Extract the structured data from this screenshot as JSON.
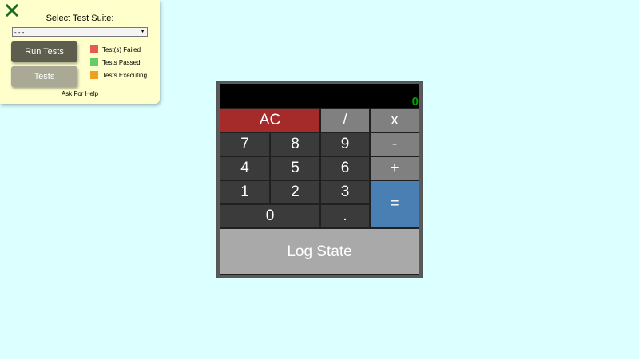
{
  "test_panel": {
    "title": "Select Test Suite:",
    "suite_select": {
      "selected": "- - -"
    },
    "run_tests_label": "Run Tests",
    "tests_label": "Tests",
    "legend": [
      {
        "label": "Test(s) Failed",
        "color": "#e85a4f"
      },
      {
        "label": "Tests Passed",
        "color": "#66cc66"
      },
      {
        "label": "Tests Executing",
        "color": "#f0a020"
      }
    ],
    "help_label": "Ask For Help",
    "close_icon": "close-icon",
    "close_color": "#1f6b1f"
  },
  "calculator": {
    "display_value": "0",
    "keys": {
      "clear": "AC",
      "divide": "/",
      "multiply": "x",
      "seven": "7",
      "eight": "8",
      "nine": "9",
      "minus": "-",
      "four": "4",
      "five": "5",
      "six": "6",
      "plus": "+",
      "one": "1",
      "two": "2",
      "three": "3",
      "equals": "=",
      "zero": "0",
      "decimal": "."
    },
    "log_state_label": "Log State"
  }
}
